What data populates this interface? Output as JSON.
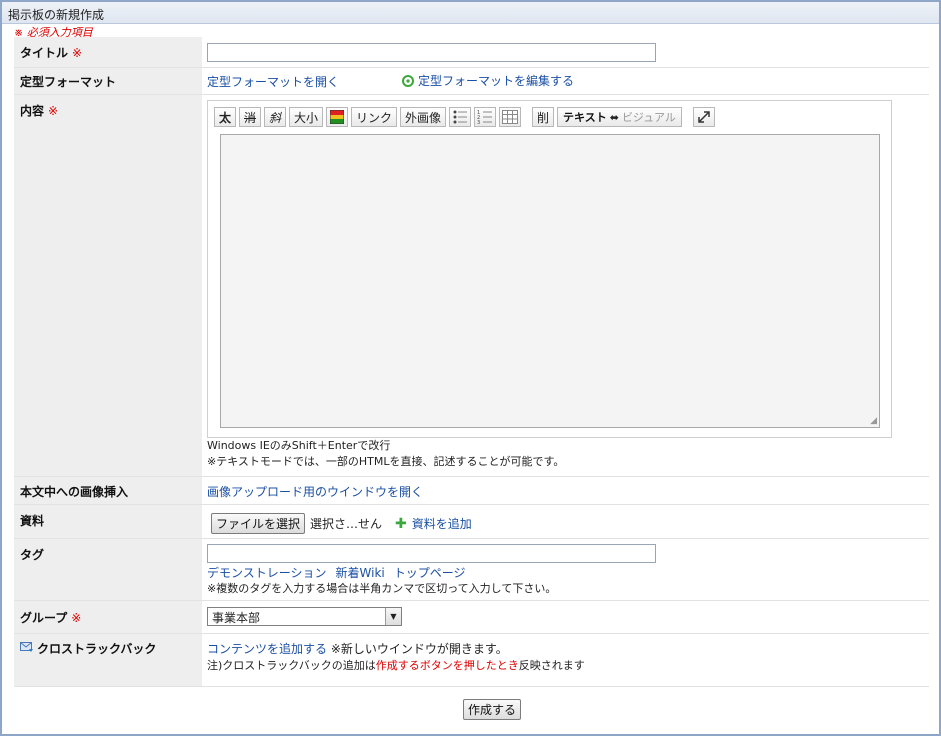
{
  "window_title": "掲示板の新規作成",
  "required_note": "※ 必須入力項目",
  "required_mark": "※",
  "title_row": {
    "label": "タイトル",
    "value": ""
  },
  "format_row": {
    "label": "定型フォーマット",
    "open_link": "定型フォーマットを開く",
    "edit_link": "定型フォーマットを編集する"
  },
  "content_row": {
    "label": "内容",
    "toolbar": {
      "bold": "太",
      "strike": "消",
      "italic": "斜",
      "size": "大小",
      "link": "リンク",
      "external_image": "外画像",
      "delete": "削",
      "mode_text": "テキスト",
      "mode_arrow": "⬌",
      "mode_visual": "ビジュアル"
    },
    "body_value": "",
    "note1": "Windows IEのみShift＋Enterで改行",
    "note2": "※テキストモードでは、一部のHTMLを直接、記述することが可能です。"
  },
  "image_row": {
    "label": "本文中への画像挿入",
    "link": "画像アップロード用のウインドウを開く"
  },
  "material_row": {
    "label": "資料",
    "file_button": "ファイルを選択",
    "file_status": "選択さ…せん",
    "add_link": "資料を追加"
  },
  "tag_row": {
    "label": "タグ",
    "value": "",
    "suggestions": [
      "デモンストレーション",
      "新着Wiki",
      "トップページ"
    ],
    "note": "※複数のタグを入力する場合は半角カンマで区切って入力して下さい。"
  },
  "group_row": {
    "label": "グループ",
    "selected": "事業本部"
  },
  "crosstrack_row": {
    "label": "クロストラックバック",
    "add_link": "コンテンツを追加する",
    "add_note": "※新しいウインドウが開きます。",
    "note_prefix": "注)クロストラックバックの追加は",
    "note_highlight": "作成するボタンを押したとき",
    "note_suffix": "反映されます"
  },
  "submit_label": "作成する"
}
